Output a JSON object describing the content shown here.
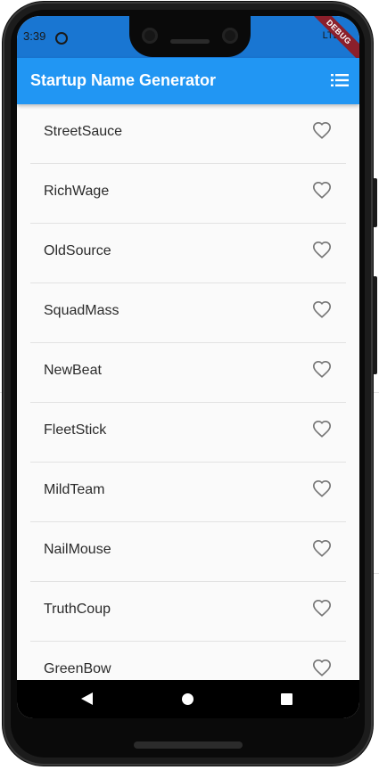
{
  "status": {
    "time": "3:39",
    "network": "LTE",
    "debug_label": "DEBUG"
  },
  "appbar": {
    "title": "Startup Name Generator",
    "action_icon": "list-icon"
  },
  "items": [
    {
      "name": "StreetSauce",
      "icon": "heart-outline-icon"
    },
    {
      "name": "RichWage",
      "icon": "heart-outline-icon"
    },
    {
      "name": "OldSource",
      "icon": "heart-outline-icon"
    },
    {
      "name": "SquadMass",
      "icon": "heart-outline-icon"
    },
    {
      "name": "NewBeat",
      "icon": "heart-outline-icon"
    },
    {
      "name": "FleetStick",
      "icon": "heart-outline-icon"
    },
    {
      "name": "MildTeam",
      "icon": "heart-outline-icon"
    },
    {
      "name": "NailMouse",
      "icon": "heart-outline-icon"
    },
    {
      "name": "TruthCoup",
      "icon": "heart-outline-icon"
    },
    {
      "name": "GreenBow",
      "icon": "heart-outline-icon"
    }
  ],
  "colors": {
    "statusbar": "#1976d2",
    "appbar": "#2196f3",
    "list_bg": "#fafafa",
    "heart": "#757575"
  },
  "navbar": {
    "icons": [
      "back-icon",
      "home-icon",
      "recents-icon"
    ]
  }
}
